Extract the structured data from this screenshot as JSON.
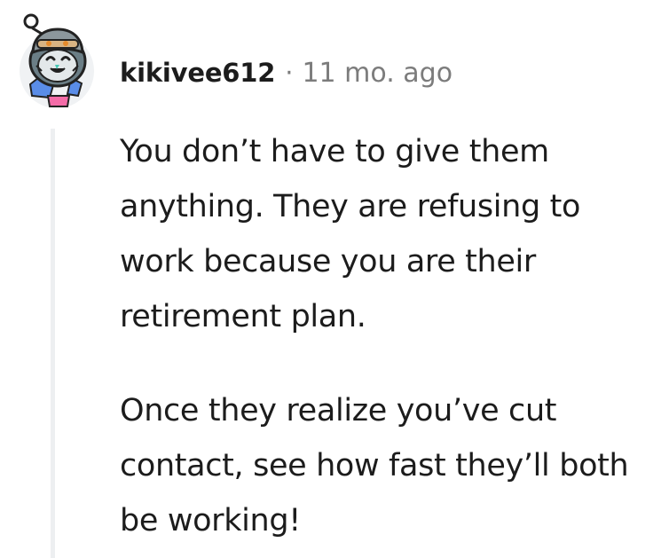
{
  "comment": {
    "author": "kikivee612",
    "separator": "·",
    "timestamp": "11 mo. ago",
    "avatar_icon": "snoo-avatar-icon",
    "paragraphs": [
      "You don’t have to give them anything. They are refusing to work because you are their retirement plan.",
      "Once they realize you’ve cut contact, see how fast they’ll both be working!"
    ]
  },
  "colors": {
    "text": "#1c1c1c",
    "meta": "#7c7c7c",
    "thread_line": "#edeff1"
  }
}
